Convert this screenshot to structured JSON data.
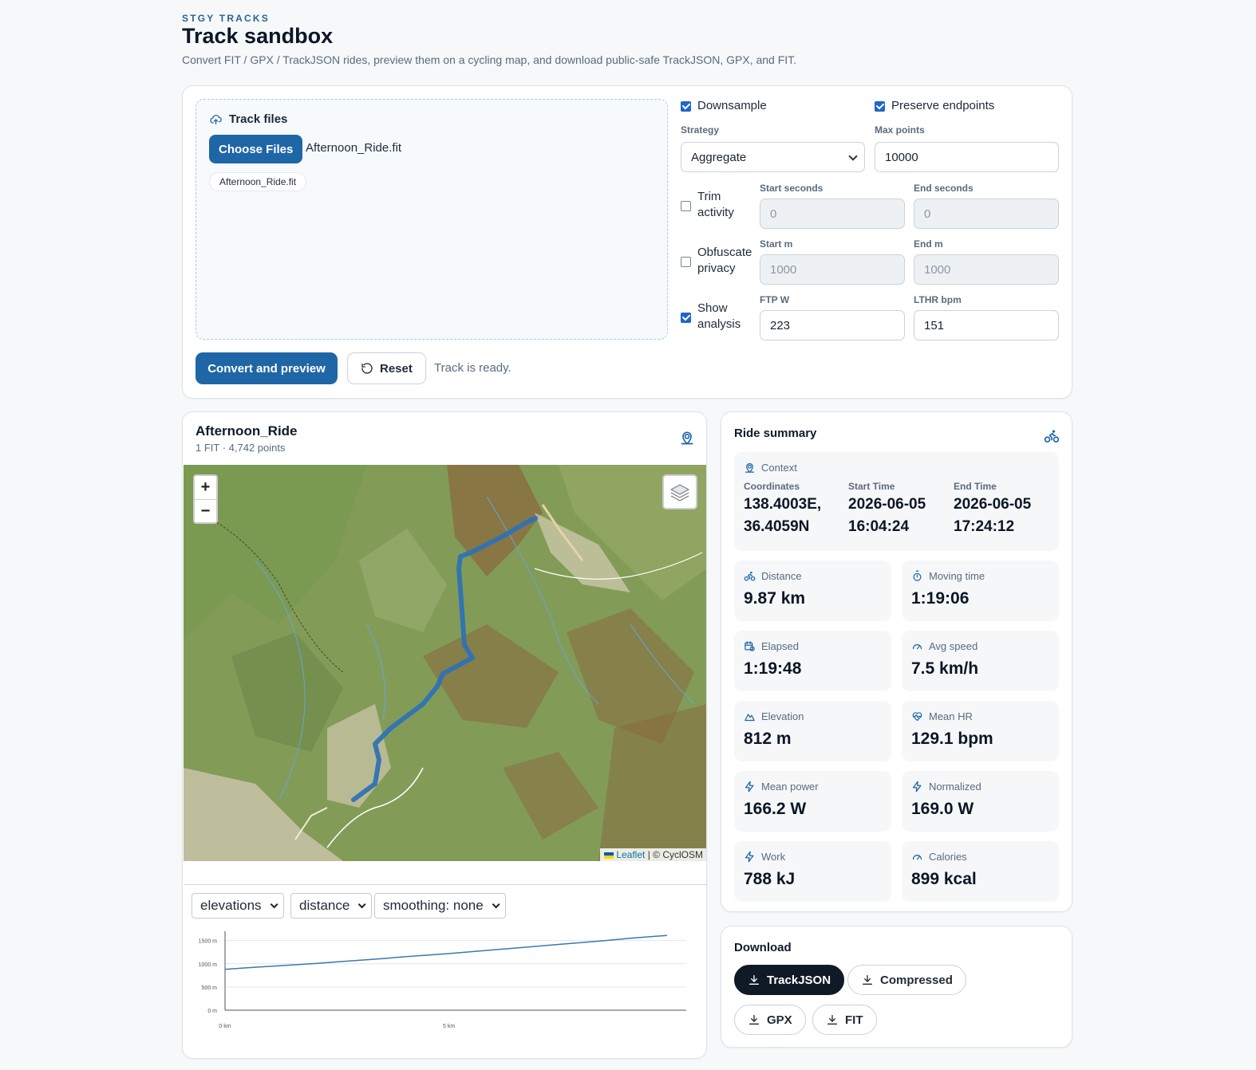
{
  "header": {
    "eyebrow": "STGY TRACKS",
    "title": "Track sandbox",
    "subtitle": "Convert FIT / GPX / TrackJSON rides, preview them on a cycling map, and download public-safe TrackJSON, GPX, and FIT."
  },
  "upload": {
    "heading": "Track files",
    "choose_label": "Choose Files",
    "chosen_name": "Afternoon_Ride.fit",
    "files": [
      "Afternoon_Ride.fit"
    ]
  },
  "options": {
    "downsample": {
      "label": "Downsample",
      "checked": true
    },
    "preserve": {
      "label": "Preserve endpoints",
      "checked": true
    },
    "strategy": {
      "label": "Strategy",
      "value": "Aggregate"
    },
    "max_points": {
      "label": "Max points",
      "value": "10000"
    },
    "trim": {
      "label_line1": "Trim",
      "label_line2": "activity",
      "checked": false,
      "start_label": "Start seconds",
      "start_value": "0",
      "end_label": "End seconds",
      "end_value": "0"
    },
    "obfuscate": {
      "label_line1": "Obfuscate",
      "label_line2": "privacy",
      "checked": false,
      "start_label": "Start m",
      "start_value": "1000",
      "end_label": "End m",
      "end_value": "1000"
    },
    "analysis": {
      "label_line1": "Show",
      "label_line2": "analysis",
      "checked": true,
      "ftp_label": "FTP W",
      "ftp_value": "223",
      "lthr_label": "LTHR bpm",
      "lthr_value": "151"
    }
  },
  "actions": {
    "convert_label": "Convert and preview",
    "reset_label": "Reset",
    "status": "Track is ready."
  },
  "map_panel": {
    "title": "Afternoon_Ride",
    "subtitle": "1 FIT · 4,742 points",
    "zoom_in": "+",
    "zoom_out": "−",
    "attribution_link": "Leaflet",
    "attribution_rest": "| © CyclOSM"
  },
  "chart_controls": {
    "metric": "elevations",
    "axis": "distance",
    "smoothing": "smoothing: none"
  },
  "chart_data": {
    "type": "line",
    "xlabel": "",
    "ylabel": "",
    "xlim": [
      0,
      10.3
    ],
    "ylim": [
      0,
      1700
    ],
    "x_ticks": [
      "0 km",
      "5 km"
    ],
    "x_tick_values": [
      0,
      5
    ],
    "y_ticks": [
      "0 m",
      "500 m",
      "1000 m",
      "1500 m"
    ],
    "y_tick_values": [
      0,
      500,
      1000,
      1500
    ],
    "grid": true,
    "series": [
      {
        "x": [
          0,
          0.5,
          1,
          1.5,
          2,
          2.5,
          3,
          3.5,
          4,
          4.5,
          5,
          5.5,
          6,
          6.5,
          7,
          7.5,
          8,
          8.5,
          9,
          9.5,
          9.87
        ],
        "values": [
          880,
          915,
          945,
          975,
          1005,
          1040,
          1075,
          1110,
          1150,
          1185,
          1220,
          1260,
          1300,
          1340,
          1380,
          1420,
          1460,
          1500,
          1545,
          1585,
          1610
        ]
      }
    ],
    "color": "#3a79ad"
  },
  "summary": {
    "title": "Ride summary",
    "context": {
      "heading": "Context",
      "coords_label": "Coordinates",
      "coords_line1": "138.4003E,",
      "coords_line2": "36.4059N",
      "start_label": "Start Time",
      "start_line1": "2026-06-05",
      "start_line2": "16:04:24",
      "end_label": "End Time",
      "end_line1": "2026-06-05",
      "end_line2": "17:24:12"
    },
    "stats": [
      {
        "label": "Distance",
        "value": "9.87 km",
        "icon": "bike-icon"
      },
      {
        "label": "Moving time",
        "value": "1:19:06",
        "icon": "stopwatch-icon"
      },
      {
        "label": "Elapsed",
        "value": "1:19:48",
        "icon": "calendar-clock-icon"
      },
      {
        "label": "Avg speed",
        "value": "7.5 km/h",
        "icon": "gauge-icon"
      },
      {
        "label": "Elevation",
        "value": "812 m",
        "icon": "mountain-icon"
      },
      {
        "label": "Mean HR",
        "value": "129.1 bpm",
        "icon": "heart-pulse-icon"
      },
      {
        "label": "Mean power",
        "value": "166.2 W",
        "icon": "bolt-icon"
      },
      {
        "label": "Normalized",
        "value": "169.0 W",
        "icon": "bolt-icon"
      },
      {
        "label": "Work",
        "value": "788 kJ",
        "icon": "bolt-icon"
      },
      {
        "label": "Calories",
        "value": "899 kcal",
        "icon": "gauge-icon"
      }
    ]
  },
  "download": {
    "title": "Download",
    "trackjson": "TrackJSON",
    "compressed": "Compressed",
    "gpx": "GPX",
    "fit": "FIT"
  },
  "colors": {
    "accent": "#1f66a7",
    "route": "#2f72b5",
    "dark_button": "#101a27"
  }
}
